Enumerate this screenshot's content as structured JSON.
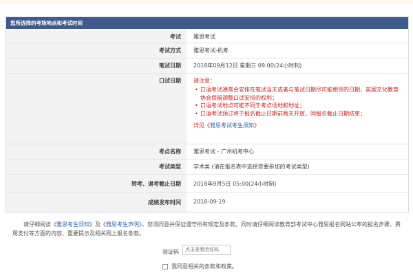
{
  "panel": {
    "title": "您所选择的考场地点和考试时间"
  },
  "rows": {
    "exam": {
      "label": "考试",
      "value": "雅思考试"
    },
    "mode": {
      "label": "考试方式",
      "value": "雅思考试-机考"
    },
    "written_date": {
      "label": "笔试日期",
      "value": "2018年09月12日 星期三 09:00(24小时制)"
    },
    "oral_date": {
      "label": "口试日期",
      "notice_title": "请注意：",
      "notices": [
        "口语考试通常会安排在笔试当天或者与笔试日期尽可能相邻的日期，英国文化教育协会保留调整口试安排的权利；",
        "口语考试地点可能不同于考点场地和地址；",
        "口语考试预订将于报名截止日期前两天开放，同报名截止日期结束；"
      ],
      "detail_prefix": "详见《",
      "detail_link": "雅思考试考生须知",
      "detail_suffix": "》"
    },
    "center": {
      "label": "考点名称",
      "value": "雅思考试 - 广州机考中心"
    },
    "type": {
      "label": "考试类型",
      "value": "学术类 (请在报名表中选择您要参加的考试类型)"
    },
    "transfer_deadline": {
      "label": "转考、退考截止日期",
      "value": "2018年9月5日 05:00(24小时制)"
    },
    "result_date": {
      "label": "成绩发布时间",
      "value": "2018-09-19"
    }
  },
  "agreement": {
    "part1": "请仔细阅读《",
    "link1": "雅思考生须知",
    "part2": "》及《",
    "link2": "雅思考生声明",
    "part3": "》，您须同意并保证遵守所有规定及条款。同时请仔细阅读教育部考试中心雅思报名网站公布的报名步骤、费用支付等方面的内容、重要提示及相关网上报名条款。"
  },
  "captcha": {
    "label": "验证码",
    "placeholder": "点击查看验证码"
  },
  "consent": {
    "label": "我同意相关的条款和政策。"
  }
}
